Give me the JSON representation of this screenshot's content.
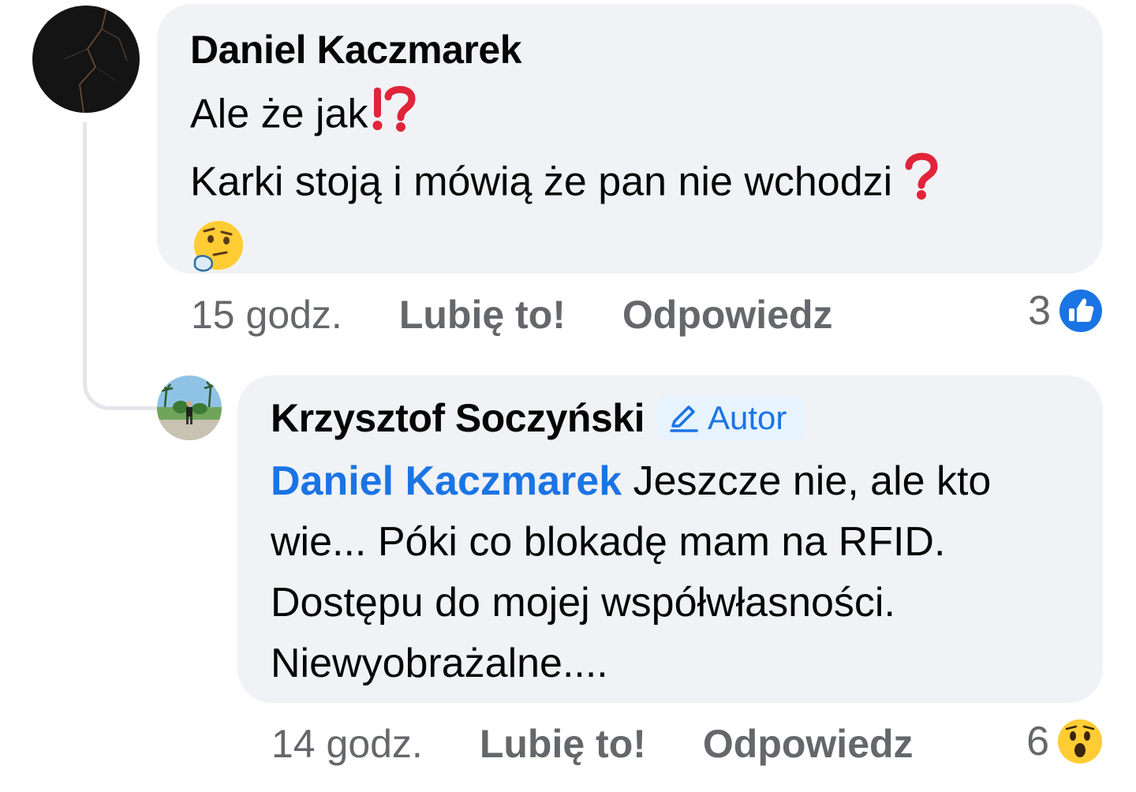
{
  "comments": [
    {
      "author": "Daniel Kaczmarek",
      "lines": [
        "Ale że jak",
        "Karki stoją i mówią że pan nie wchodzi"
      ],
      "time": "15 godz.",
      "like_label": "Lubię to!",
      "reply_label": "Odpowiedz",
      "reaction_count": "3",
      "reaction_icon": "like-icon",
      "line_emojis": [
        "exclamation-question-mark-emoji",
        "red-question-mark-emoji",
        "thinking-face-emoji"
      ]
    },
    {
      "author": "Krzysztof Soczyński",
      "badge": "Autor",
      "mention": "Daniel Kaczmarek",
      "lines": [
        " Jeszcze nie, ale kto",
        "wie... Póki co blokadę mam na RFID.",
        "Dostępu do mojej współwłasności.",
        "Niewyobrażalne...."
      ],
      "time": "14 godz.",
      "like_label": "Lubię to!",
      "reply_label": "Odpowiedz",
      "reaction_count": "6",
      "reaction_icon": "wow-icon"
    }
  ],
  "colors": {
    "bubble": "#f0f2f5",
    "link": "#1b74e4",
    "meta": "#65676b",
    "badge_bg": "#e7f3ff"
  }
}
